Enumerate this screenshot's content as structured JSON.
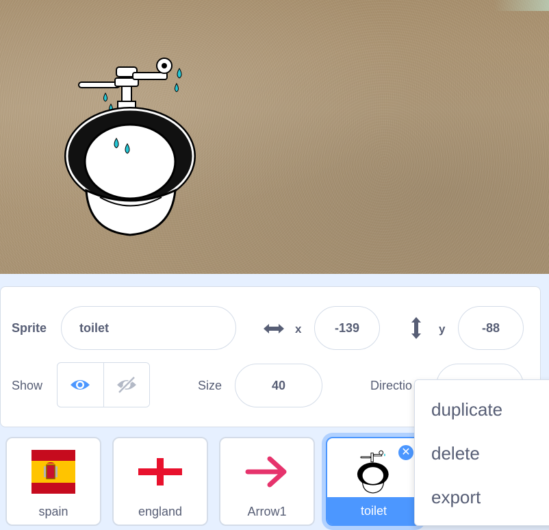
{
  "stage": {
    "sprite_name": "toilet"
  },
  "sprite_info": {
    "sprite_label": "Sprite",
    "sprite_name": "toilet",
    "x_label": "x",
    "x_value": "-139",
    "y_label": "y",
    "y_value": "-88",
    "show_label": "Show",
    "size_label": "Size",
    "size_value": "40",
    "direction_label": "Directio",
    "visible": true
  },
  "sprites": [
    {
      "name": "spain",
      "selected": false
    },
    {
      "name": "england",
      "selected": false
    },
    {
      "name": "Arrow1",
      "selected": false
    },
    {
      "name": "toilet",
      "selected": true
    }
  ],
  "context_menu": {
    "items": [
      "duplicate",
      "delete",
      "export"
    ]
  },
  "colors": {
    "accent": "#4c97ff",
    "text": "#575e75",
    "arrow": "#e6336c"
  },
  "icons": {
    "show": "eye-icon",
    "hide": "eye-slash-icon",
    "x": "horizontal-arrows-icon",
    "y": "vertical-arrows-icon",
    "delete": "close-icon"
  }
}
